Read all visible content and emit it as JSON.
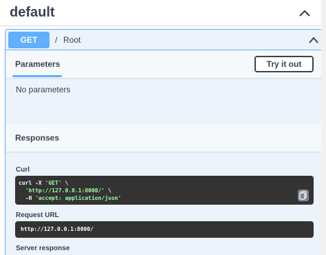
{
  "tag": {
    "title": "default"
  },
  "operation": {
    "method": "GET",
    "separator": "/",
    "path": "Root"
  },
  "parameters": {
    "title": "Parameters",
    "try_button": "Try it out",
    "empty_text": "No parameters"
  },
  "responses": {
    "title": "Responses",
    "curl_label": "Curl",
    "curl_lines": [
      {
        "cmd": "curl -X ",
        "str": "'GET'",
        "rest": " \\"
      },
      {
        "cmd": "  ",
        "str": "'http://127.0.0.1:8000/'",
        "rest": " \\"
      },
      {
        "cmd": "  -H ",
        "str": "'accept: application/json'",
        "rest": ""
      }
    ],
    "request_url_label": "Request URL",
    "request_url": "http://127.0.0.1:8000/",
    "server_response_label": "Server response"
  },
  "colors": {
    "get_accent": "#61affe",
    "block_bg": "#ecf3fa",
    "code_bg": "#333333",
    "string_green": "#a2fca2"
  },
  "icons": [
    "chevron-up-icon",
    "copy-icon"
  ]
}
